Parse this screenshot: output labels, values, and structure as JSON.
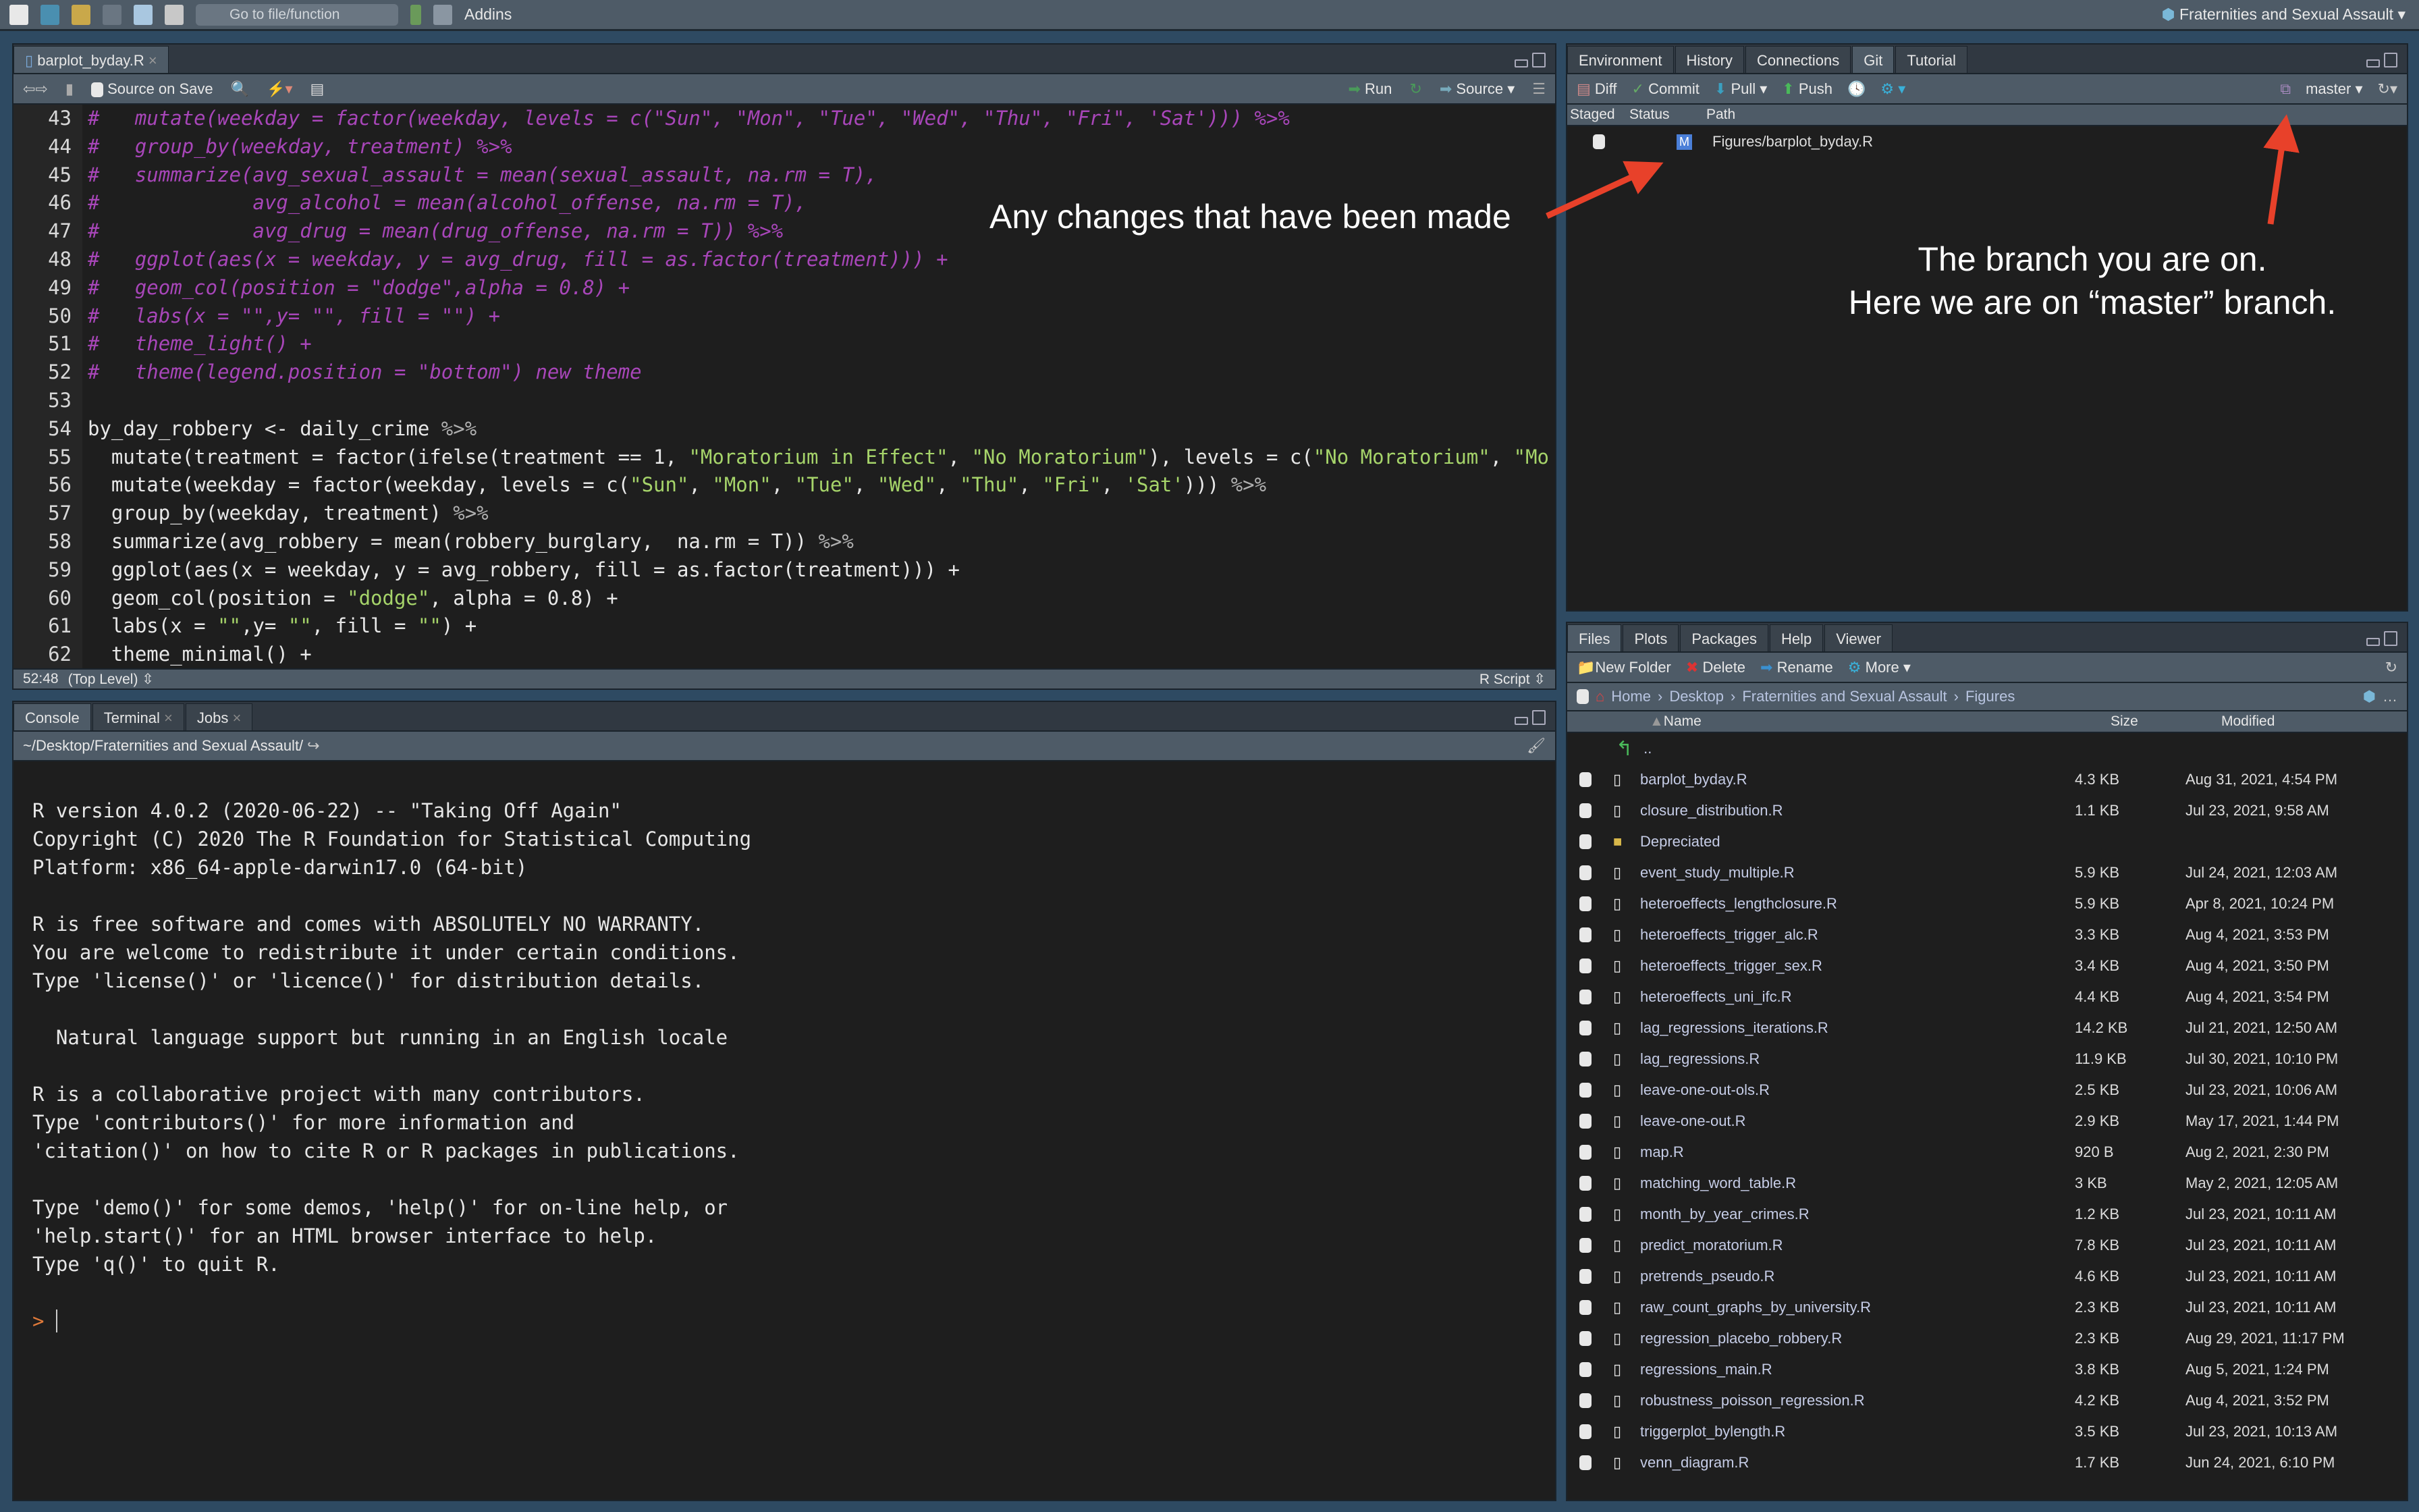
{
  "toolbar": {
    "goto_placeholder": "Go to file/function",
    "addins": "Addins",
    "project": "Fraternities and Sexual Assault"
  },
  "editor": {
    "tab": "barplot_byday.R",
    "source_on_save": "Source on Save",
    "run": "Run",
    "source": "Source",
    "lines": [
      {
        "n": "43",
        "t": "#   mutate(weekday = factor(weekday, levels = c(\"Sun\", \"Mon\", \"Tue\", \"Wed\", \"Thu\", \"Fri\", 'Sat'))) %>%",
        "comment": true
      },
      {
        "n": "44",
        "t": "#   group_by(weekday, treatment) %>%",
        "comment": true
      },
      {
        "n": "45",
        "t": "#   summarize(avg_sexual_assault = mean(sexual_assault, na.rm = T),",
        "comment": true
      },
      {
        "n": "46",
        "t": "#             avg_alcohol = mean(alcohol_offense, na.rm = T),",
        "comment": true
      },
      {
        "n": "47",
        "t": "#             avg_drug = mean(drug_offense, na.rm = T)) %>%",
        "comment": true
      },
      {
        "n": "48",
        "t": "#   ggplot(aes(x = weekday, y = avg_drug, fill = as.factor(treatment))) +",
        "comment": true
      },
      {
        "n": "49",
        "t": "#   geom_col(position = \"dodge\",alpha = 0.8) +",
        "comment": true
      },
      {
        "n": "50",
        "t": "#   labs(x = \"\",y= \"\", fill = \"\") +",
        "comment": true
      },
      {
        "n": "51",
        "t": "#   theme_light() +",
        "comment": true
      },
      {
        "n": "52",
        "t": "#   theme(legend.position = \"bottom\") new theme",
        "comment": true
      },
      {
        "n": "53",
        "t": "",
        "comment": false
      },
      {
        "n": "54",
        "t": "by_day_robbery <- daily_crime %>%",
        "comment": false
      },
      {
        "n": "55",
        "t": "  mutate(treatment = factor(ifelse(treatment == 1, \"Moratorium in Effect\", \"No Moratorium\"), levels = c(\"No Moratorium\", \"Mo",
        "comment": false
      },
      {
        "n": "56",
        "t": "  mutate(weekday = factor(weekday, levels = c(\"Sun\", \"Mon\", \"Tue\", \"Wed\", \"Thu\", \"Fri\", 'Sat'))) %>%",
        "comment": false
      },
      {
        "n": "57",
        "t": "  group_by(weekday, treatment) %>%",
        "comment": false
      },
      {
        "n": "58",
        "t": "  summarize(avg_robbery = mean(robbery_burglary,  na.rm = T)) %>%",
        "comment": false
      },
      {
        "n": "59",
        "t": "  ggplot(aes(x = weekday, y = avg_robbery, fill = as.factor(treatment))) +",
        "comment": false
      },
      {
        "n": "60",
        "t": "  geom_col(position = \"dodge\", alpha = 0.8) +",
        "comment": false
      },
      {
        "n": "61",
        "t": "  labs(x = \"\",y= \"\", fill = \"\") +",
        "comment": false
      },
      {
        "n": "62",
        "t": "  theme_minimal() +",
        "comment": false
      }
    ],
    "cursor_pos": "52:48",
    "scope": "(Top Level)",
    "file_type": "R Script"
  },
  "console": {
    "tabs": [
      "Console",
      "Terminal",
      "Jobs"
    ],
    "path": "~/Desktop/Fraternities and Sexual Assault/",
    "lines": [
      "",
      "R version 4.0.2 (2020-06-22) -- \"Taking Off Again\"",
      "Copyright (C) 2020 The R Foundation for Statistical Computing",
      "Platform: x86_64-apple-darwin17.0 (64-bit)",
      "",
      "R is free software and comes with ABSOLUTELY NO WARRANTY.",
      "You are welcome to redistribute it under certain conditions.",
      "Type 'license()' or 'licence()' for distribution details.",
      "",
      "  Natural language support but running in an English locale",
      "",
      "R is a collaborative project with many contributors.",
      "Type 'contributors()' for more information and",
      "'citation()' on how to cite R or R packages in publications.",
      "",
      "Type 'demo()' for some demos, 'help()' for on-line help, or",
      "'help.start()' for an HTML browser interface to help.",
      "Type 'q()' to quit R.",
      ""
    ],
    "prompt": ">"
  },
  "git": {
    "tabs": [
      "Environment",
      "History",
      "Connections",
      "Git",
      "Tutorial"
    ],
    "active_tab": "Git",
    "buttons": {
      "diff": "Diff",
      "commit": "Commit",
      "pull": "Pull",
      "push": "Push"
    },
    "branch": "master",
    "headers": {
      "staged": "Staged",
      "status": "Status",
      "path": "Path"
    },
    "changes": [
      {
        "status": "M",
        "path": "Figures/barplot_byday.R"
      }
    ]
  },
  "files": {
    "tabs": [
      "Files",
      "Plots",
      "Packages",
      "Help",
      "Viewer"
    ],
    "active_tab": "Files",
    "buttons": {
      "new_folder": "New Folder",
      "delete": "Delete",
      "rename": "Rename",
      "more": "More"
    },
    "breadcrumb": [
      "Home",
      "Desktop",
      "Fraternities and Sexual Assault",
      "Figures"
    ],
    "headers": {
      "name": "Name",
      "size": "Size",
      "modified": "Modified"
    },
    "parent": "..",
    "rows": [
      {
        "name": "barplot_byday.R",
        "size": "4.3 KB",
        "modified": "Aug 31, 2021, 4:54 PM",
        "type": "r"
      },
      {
        "name": "closure_distribution.R",
        "size": "1.1 KB",
        "modified": "Jul 23, 2021, 9:58 AM",
        "type": "r"
      },
      {
        "name": "Depreciated",
        "size": "",
        "modified": "",
        "type": "folder"
      },
      {
        "name": "event_study_multiple.R",
        "size": "5.9 KB",
        "modified": "Jul 24, 2021, 12:03 AM",
        "type": "r"
      },
      {
        "name": "heteroeffects_lengthclosure.R",
        "size": "5.9 KB",
        "modified": "Apr 8, 2021, 10:24 PM",
        "type": "r"
      },
      {
        "name": "heteroeffects_trigger_alc.R",
        "size": "3.3 KB",
        "modified": "Aug 4, 2021, 3:53 PM",
        "type": "r"
      },
      {
        "name": "heteroeffects_trigger_sex.R",
        "size": "3.4 KB",
        "modified": "Aug 4, 2021, 3:50 PM",
        "type": "r"
      },
      {
        "name": "heteroeffects_uni_ifc.R",
        "size": "4.4 KB",
        "modified": "Aug 4, 2021, 3:54 PM",
        "type": "r"
      },
      {
        "name": "lag_regressions_iterations.R",
        "size": "14.2 KB",
        "modified": "Jul 21, 2021, 12:50 AM",
        "type": "r"
      },
      {
        "name": "lag_regressions.R",
        "size": "11.9 KB",
        "modified": "Jul 30, 2021, 10:10 PM",
        "type": "r"
      },
      {
        "name": "leave-one-out-ols.R",
        "size": "2.5 KB",
        "modified": "Jul 23, 2021, 10:06 AM",
        "type": "r"
      },
      {
        "name": "leave-one-out.R",
        "size": "2.9 KB",
        "modified": "May 17, 2021, 1:44 PM",
        "type": "r"
      },
      {
        "name": "map.R",
        "size": "920 B",
        "modified": "Aug 2, 2021, 2:30 PM",
        "type": "r"
      },
      {
        "name": "matching_word_table.R",
        "size": "3 KB",
        "modified": "May 2, 2021, 12:05 AM",
        "type": "r"
      },
      {
        "name": "month_by_year_crimes.R",
        "size": "1.2 KB",
        "modified": "Jul 23, 2021, 10:11 AM",
        "type": "r"
      },
      {
        "name": "predict_moratorium.R",
        "size": "7.8 KB",
        "modified": "Jul 23, 2021, 10:11 AM",
        "type": "r"
      },
      {
        "name": "pretrends_pseudo.R",
        "size": "4.6 KB",
        "modified": "Jul 23, 2021, 10:11 AM",
        "type": "r"
      },
      {
        "name": "raw_count_graphs_by_university.R",
        "size": "2.3 KB",
        "modified": "Jul 23, 2021, 10:11 AM",
        "type": "r"
      },
      {
        "name": "regression_placebo_robbery.R",
        "size": "2.3 KB",
        "modified": "Aug 29, 2021, 11:17 PM",
        "type": "r"
      },
      {
        "name": "regressions_main.R",
        "size": "3.8 KB",
        "modified": "Aug 5, 2021, 1:24 PM",
        "type": "r"
      },
      {
        "name": "robustness_poisson_regression.R",
        "size": "4.2 KB",
        "modified": "Aug 4, 2021, 3:52 PM",
        "type": "r"
      },
      {
        "name": "triggerplot_bylength.R",
        "size": "3.5 KB",
        "modified": "Jul 23, 2021, 10:13 AM",
        "type": "r"
      },
      {
        "name": "venn_diagram.R",
        "size": "1.7 KB",
        "modified": "Jun 24, 2021, 6:10 PM",
        "type": "r"
      }
    ]
  },
  "annotations": {
    "changes": "Any changes that have been made",
    "branch_line1": "The branch you are on.",
    "branch_line2": "Here we are on “master” branch.",
    "arrow_color": "#e8412a"
  },
  "colors": {
    "comment": "#a846b9",
    "string": "#a6d46a",
    "background": "#1e1e1e",
    "chrome": "#4e5b67"
  }
}
